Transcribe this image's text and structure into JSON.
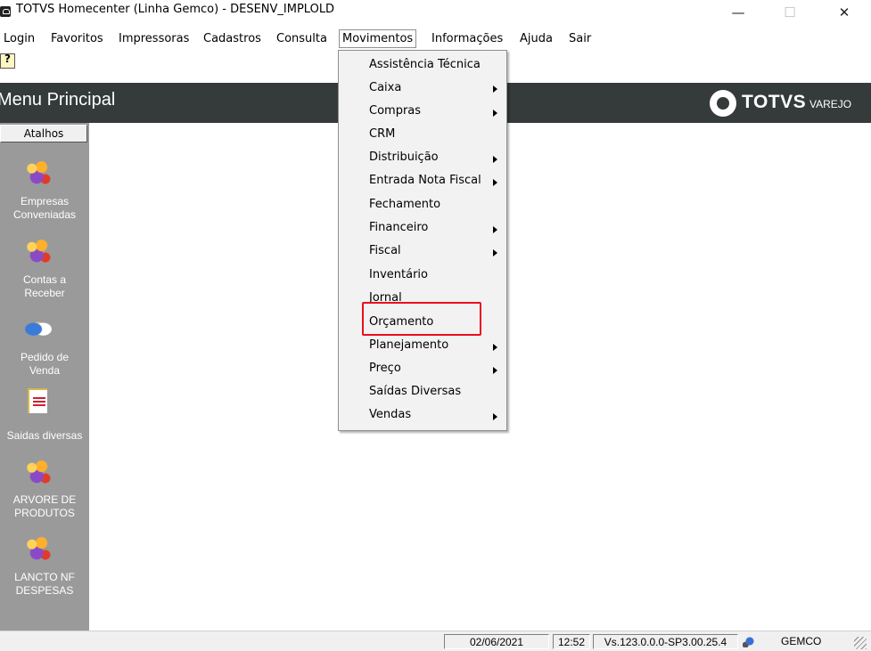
{
  "window": {
    "title": "TOTVS Homecenter (Linha Gemco) - DESENV_IMPLOLD",
    "minimize": "—",
    "maximize": "☐",
    "close": "✕"
  },
  "menubar": {
    "items": [
      {
        "label": "Login"
      },
      {
        "label": "Favoritos"
      },
      {
        "label": "Impressoras"
      },
      {
        "label": "Cadastros"
      },
      {
        "label": "Consulta"
      },
      {
        "label": "Movimentos"
      },
      {
        "label": "Informações"
      },
      {
        "label": "Ajuda"
      },
      {
        "label": "Sair"
      }
    ]
  },
  "header": {
    "title": "Menu Principal",
    "logo_word": "TOTVS",
    "logo_sub": "VAREJO"
  },
  "sidebar": {
    "tab": "Atalhos",
    "shortcuts": [
      {
        "label1": "Empresas",
        "label2": "Conveniadas",
        "icon": "people-group-icon"
      },
      {
        "label1": "Contas a",
        "label2": "Receber",
        "icon": "people-group-icon"
      },
      {
        "label1": "Pedido de",
        "label2": "Venda",
        "icon": "handshake-icon"
      },
      {
        "label1": "Saidas diversas",
        "label2": "",
        "icon": "document-icon"
      },
      {
        "label1": "ARVORE DE",
        "label2": "PRODUTOS",
        "icon": "people-group-icon"
      },
      {
        "label1": "LANCTO NF",
        "label2": "DESPESAS",
        "icon": "people-group-icon"
      }
    ]
  },
  "dropdown": {
    "items": [
      {
        "label": "Assistência Técnica",
        "submenu": false
      },
      {
        "label": "Caixa",
        "submenu": true
      },
      {
        "label": "Compras",
        "submenu": true
      },
      {
        "label": "CRM",
        "submenu": false
      },
      {
        "label": "Distribuição",
        "submenu": true
      },
      {
        "label": "Entrada Nota Fiscal",
        "submenu": true
      },
      {
        "label": "Fechamento",
        "submenu": false
      },
      {
        "label": "Financeiro",
        "submenu": true
      },
      {
        "label": "Fiscal",
        "submenu": true
      },
      {
        "label": "Inventário",
        "submenu": false
      },
      {
        "label": "Jornal",
        "submenu": false
      },
      {
        "label": "Orçamento",
        "submenu": false
      },
      {
        "label": "Planejamento",
        "submenu": true
      },
      {
        "label": "Preço",
        "submenu": true
      },
      {
        "label": "Saídas Diversas",
        "submenu": false
      },
      {
        "label": "Vendas",
        "submenu": true
      }
    ],
    "highlight_color": "#e8101f"
  },
  "statusbar": {
    "date": "02/06/2021",
    "time": "12:52",
    "version": "Vs.123.0.0.0-SP3.00.25.4",
    "user": "GEMCO"
  },
  "colors": {
    "header_bg": "#353b3b",
    "sidebar_bg": "#9a9a9a"
  }
}
